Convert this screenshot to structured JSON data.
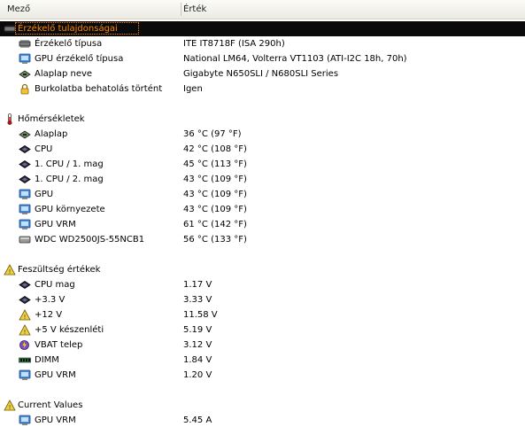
{
  "header": {
    "field": "Mező",
    "value": "Érték"
  },
  "sections": [
    {
      "title": "Érzékelő tulajdonságai",
      "icon": "sensor-icon",
      "items": [
        {
          "label": "Érzékelő típusa",
          "value": "ITE IT8718F  (ISA 290h)",
          "icon": "sensor-icon"
        },
        {
          "label": "GPU érzékelő típusa",
          "value": "National LM64, Volterra VT1103  (ATI-I2C 18h, 70h)",
          "icon": "gpu-icon"
        },
        {
          "label": "Alaplap neve",
          "value": "Gigabyte N650SLI / N680SLI Series",
          "icon": "motherboard-icon"
        },
        {
          "label": "Burkolatba behatolás történt",
          "value": "Igen",
          "icon": "lock-icon"
        }
      ]
    },
    {
      "title": "Hőmérsékletek",
      "icon": "thermometer-icon",
      "items": [
        {
          "label": "Alaplap",
          "value": "36 °C  (97 °F)",
          "icon": "motherboard-icon"
        },
        {
          "label": "CPU",
          "value": "42 °C  (108 °F)",
          "icon": "cpu-icon"
        },
        {
          "label": "1. CPU / 1. mag",
          "value": "45 °C  (113 °F)",
          "icon": "cpu-icon"
        },
        {
          "label": "1. CPU / 2. mag",
          "value": "43 °C  (109 °F)",
          "icon": "cpu-icon"
        },
        {
          "label": "GPU",
          "value": "43 °C  (109 °F)",
          "icon": "gpu-icon"
        },
        {
          "label": "GPU környezete",
          "value": "43 °C  (109 °F)",
          "icon": "gpu-icon"
        },
        {
          "label": "GPU VRM",
          "value": "61 °C  (142 °F)",
          "icon": "gpu-icon"
        },
        {
          "label": "WDC WD2500JS-55NCB1",
          "value": "56 °C  (133 °F)",
          "icon": "hdd-icon"
        }
      ]
    },
    {
      "title": "Feszültség értékek",
      "icon": "voltage-icon",
      "items": [
        {
          "label": "CPU mag",
          "value": "1.17 V",
          "icon": "cpu-icon"
        },
        {
          "label": "+3.3 V",
          "value": "3.33 V",
          "icon": "cpu-icon"
        },
        {
          "label": "+12 V",
          "value": "11.58 V",
          "icon": "voltage-icon"
        },
        {
          "label": "+5 V készenléti",
          "value": "5.19 V",
          "icon": "voltage-icon"
        },
        {
          "label": "VBAT telep",
          "value": "3.12 V",
          "icon": "battery-icon"
        },
        {
          "label": "DIMM",
          "value": "1.84 V",
          "icon": "memory-icon"
        },
        {
          "label": "GPU VRM",
          "value": "1.20 V",
          "icon": "gpu-icon"
        }
      ]
    },
    {
      "title": "Current Values",
      "icon": "current-icon",
      "items": [
        {
          "label": "GPU VRM",
          "value": "5.45 A",
          "icon": "gpu-icon"
        }
      ]
    }
  ]
}
